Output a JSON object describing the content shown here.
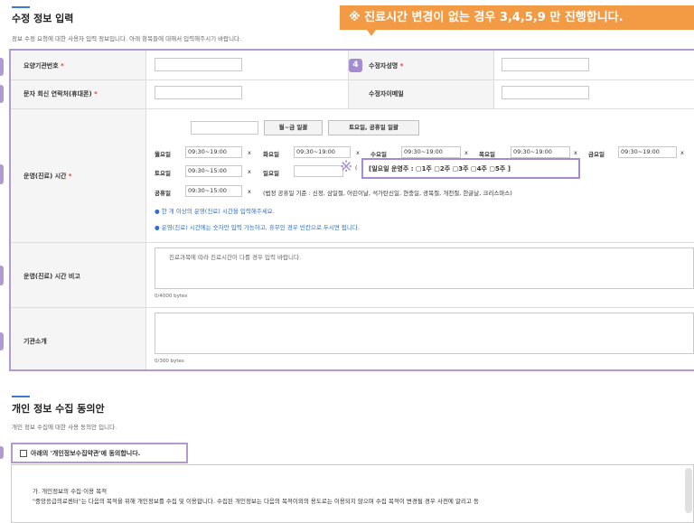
{
  "section1": {
    "title": "수정 정보 입력",
    "description": "정보 수정 요청에 대한 사용자 입력 정보입니다. 아래 항목들에 대해서 입력해주시기 바랍니다."
  },
  "callout": "※ 진료시간 변경이 없는 경우 3,4,5,9 만 진행합니다.",
  "badge4": "4",
  "labels": {
    "institution_no": "요양기관번호",
    "sms_contact": "문자 회신 연락처(휴대폰)",
    "modifier_name": "수정자성명",
    "modifier_email": "수정자이메일",
    "hours": "운영(진료) 시간",
    "hours_note": "운영(진료) 시간 비고",
    "intro": "기관소개",
    "required_mark": "*"
  },
  "hours": {
    "btn_weekday": "월~금 일괄",
    "btn_weekend": "토요일, 공휴일 일괄",
    "x": "x",
    "days": [
      {
        "day": "월요일",
        "time": "09:30~19:00"
      },
      {
        "day": "화요일",
        "time": "09:30~19:00"
      },
      {
        "day": "수요일",
        "time": "09:30~19:00"
      },
      {
        "day": "목요일",
        "time": "09:30~19:00"
      },
      {
        "day": "금요일",
        "time": "09:30~19:00"
      },
      {
        "day": "토요일",
        "time": "09:30~15:00"
      },
      {
        "day": "일요일",
        "time": ""
      },
      {
        "day": "공휴일",
        "time": "09:30~15:00"
      }
    ],
    "ref_mark": "※",
    "ref_small": "(",
    "sunday_ops": "[일요일 운영주 : ▢1주 ▢2주 ▢3주 ▢4주 ▢5주 ]",
    "holiday_criteria": "(법정 공휴일 기준 : 신정, 삼일절, 어린이날, 석가탄신일, 현충일, 광복절, 개천절, 한글날, 크리스마스)",
    "note1": "● 한 개 이상의 운영(진료) 시간을 입력해주세요.",
    "note2": "● 운영(진료) 시간에는 숫자만 입력 가능하고, 휴무인 경우 빈칸으로 두시면 됩니다."
  },
  "hours_note": {
    "placeholder": "진료과목에 따라 진료시간이 다를 경우 입력 바랍니다.",
    "bytes": "0/4000 bytes"
  },
  "intro": {
    "bytes": "0/300 bytes"
  },
  "section2": {
    "title": "개인 정보 수집 동의안",
    "description": "개인 정보 수집에 대한 사용 동의안 입니다.",
    "consent_label": "아래의 '개인정보수집약관'에 동의합니다.",
    "terms_title": "가. 개인정보의 수집·이용 목적",
    "terms_body": "\"중앙응급의료센터\"는 다음의 목적을 위해 개인정보를 수집 및 이용합니다. 수집된 개인정보는 다음의 목적이외의 용도로는 이용되지 않으며 수집 목적이 변경될 경우 사전에 알리고 동"
  },
  "colors": {
    "accent_orange": "#f39a45",
    "highlight_purple": "#a58bd0",
    "link_blue": "#2f6fd1",
    "required_red": "#e53935"
  }
}
